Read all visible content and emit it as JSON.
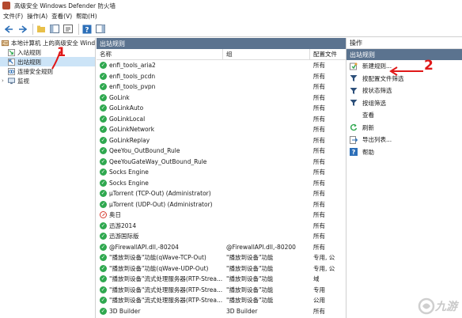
{
  "window": {
    "title": "高级安全 Windows Defender 防火墙"
  },
  "menu": [
    "文件(F)",
    "操作(A)",
    "查看(V)",
    "帮助(H)"
  ],
  "tree": {
    "root": "本地计算机 上的高级安全 Windows",
    "items": [
      {
        "label": "入站规则",
        "icon": "inbound-rules-icon"
      },
      {
        "label": "出站规则",
        "icon": "outbound-rules-icon",
        "selected": true
      },
      {
        "label": "连接安全规则",
        "icon": "connection-security-icon"
      },
      {
        "label": "监视",
        "icon": "monitor-icon"
      }
    ]
  },
  "center": {
    "header": "出站规则",
    "columns": [
      "名称",
      "组",
      "配置文件"
    ],
    "rows": [
      {
        "name": "enfi_tools_aria2",
        "group": "",
        "profile": "所有",
        "status": "allow"
      },
      {
        "name": "enfi_tools_pcdn",
        "group": "",
        "profile": "所有",
        "status": "allow"
      },
      {
        "name": "enfi_tools_pvpn",
        "group": "",
        "profile": "所有",
        "status": "allow"
      },
      {
        "name": "GoLink",
        "group": "",
        "profile": "所有",
        "status": "allow"
      },
      {
        "name": "GoLinkAuto",
        "group": "",
        "profile": "所有",
        "status": "allow"
      },
      {
        "name": "GoLinkLocal",
        "group": "",
        "profile": "所有",
        "status": "allow"
      },
      {
        "name": "GoLinkNetwork",
        "group": "",
        "profile": "所有",
        "status": "allow"
      },
      {
        "name": "GoLinkReplay",
        "group": "",
        "profile": "所有",
        "status": "allow"
      },
      {
        "name": "QeeYou_OutBound_Rule",
        "group": "",
        "profile": "所有",
        "status": "allow"
      },
      {
        "name": "QeeYouGateWay_OutBound_Rule",
        "group": "",
        "profile": "所有",
        "status": "allow"
      },
      {
        "name": "Socks Engine",
        "group": "",
        "profile": "所有",
        "status": "allow"
      },
      {
        "name": "Socks Engine",
        "group": "",
        "profile": "所有",
        "status": "allow"
      },
      {
        "name": "µTorrent (TCP-Out) (Administrator)",
        "group": "",
        "profile": "所有",
        "status": "allow"
      },
      {
        "name": "µTorrent (UDP-Out) (Administrator)",
        "group": "",
        "profile": "所有",
        "status": "allow"
      },
      {
        "name": "奥日",
        "group": "",
        "profile": "所有",
        "status": "block"
      },
      {
        "name": "迅游2014",
        "group": "",
        "profile": "所有",
        "status": "allow"
      },
      {
        "name": "迅游国际版",
        "group": "",
        "profile": "所有",
        "status": "allow"
      },
      {
        "name": "@FirewallAPI.dll,-80204",
        "group": "@FirewallAPI.dll,-80200",
        "profile": "所有",
        "status": "allow"
      },
      {
        "name": "\"播放到设备\"功能(qWave-TCP-Out)",
        "group": "\"播放到设备\"功能",
        "profile": "专用, 公",
        "status": "allow"
      },
      {
        "name": "\"播放到设备\"功能(qWave-UDP-Out)",
        "group": "\"播放到设备\"功能",
        "profile": "专用, 公",
        "status": "allow"
      },
      {
        "name": "\"播放到设备\"流式处理服务器(RTP-Strea...",
        "group": "\"播放到设备\"功能",
        "profile": "域",
        "status": "allow"
      },
      {
        "name": "\"播放到设备\"流式处理服务器(RTP-Strea...",
        "group": "\"播放到设备\"功能",
        "profile": "专用",
        "status": "allow"
      },
      {
        "name": "\"播放到设备\"流式处理服务器(RTP-Strea...",
        "group": "\"播放到设备\"功能",
        "profile": "公用",
        "status": "allow"
      },
      {
        "name": "3D Builder",
        "group": "3D Builder",
        "profile": "所有",
        "status": "allow"
      }
    ]
  },
  "actions": {
    "header": "操作",
    "section": "出站规则",
    "items": [
      {
        "label": "新建规则...",
        "icon": "new-rule-icon"
      },
      {
        "label": "按配置文件筛选",
        "icon": "filter-icon"
      },
      {
        "label": "按状态筛选",
        "icon": "filter-icon"
      },
      {
        "label": "按组筛选",
        "icon": "filter-icon"
      },
      {
        "label": "查看",
        "icon": ""
      },
      {
        "label": "刷新",
        "icon": "refresh-icon"
      },
      {
        "label": "导出列表...",
        "icon": "export-icon"
      },
      {
        "label": "帮助",
        "icon": "help-icon"
      }
    ]
  },
  "annotations": {
    "mark1": "1",
    "mark2": "2"
  },
  "watermark": "九游"
}
